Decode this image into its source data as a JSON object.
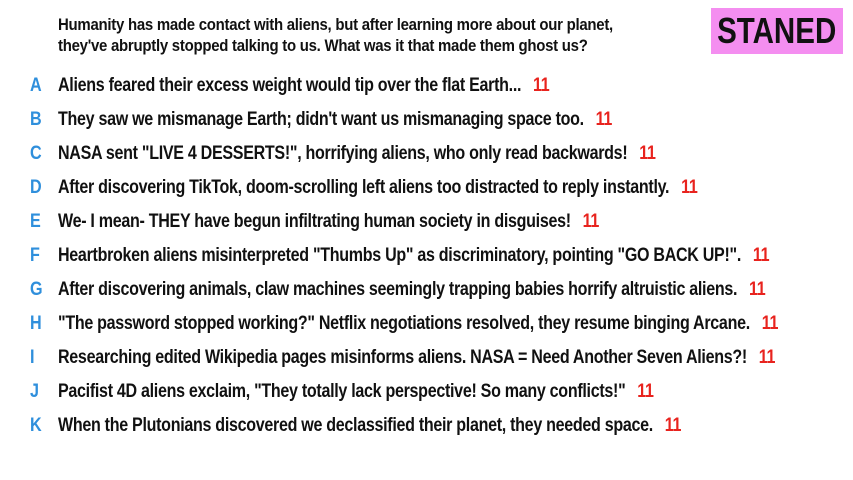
{
  "prompt": {
    "line1": "Humanity has made contact with aliens, but after learning more about our planet,",
    "line2": "they've abruptly stopped talking to us. What was it that made them ghost us?"
  },
  "badge": {
    "label": "STANED",
    "color": "#f48ef0"
  },
  "colors": {
    "letter": "#2f8fdc",
    "score": "#e8231e"
  },
  "answers": [
    {
      "letter": "A",
      "text": "Aliens feared their excess weight would tip over the flat Earth...",
      "score": "11"
    },
    {
      "letter": "B",
      "text": "They saw we mismanage Earth; didn't want us mismanaging space too.",
      "score": "11"
    },
    {
      "letter": "C",
      "text": "NASA sent \"LIVE 4 DESSERTS!\", horrifying aliens, who only read backwards!",
      "score": "11"
    },
    {
      "letter": "D",
      "text": "After discovering TikTok, doom-scrolling left aliens too distracted to reply instantly.",
      "score": "11"
    },
    {
      "letter": "E",
      "text": "We- I mean- THEY have begun infiltrating human society in disguises!",
      "score": "11"
    },
    {
      "letter": "F",
      "text": "Heartbroken aliens misinterpreted \"Thumbs Up\" as discriminatory, pointing \"GO BACK UP!\".",
      "score": "11"
    },
    {
      "letter": "G",
      "text": "After discovering animals, claw machines seemingly trapping babies horrify altruistic aliens.",
      "score": "11"
    },
    {
      "letter": "H",
      "text": "\"The password stopped working?\" Netflix negotiations resolved, they resume binging Arcane.",
      "score": "11"
    },
    {
      "letter": "I",
      "text": "Researching edited Wikipedia pages misinforms aliens. NASA = Need Another Seven Aliens?!",
      "score": "11"
    },
    {
      "letter": "J",
      "text": "Pacifist 4D aliens exclaim, \"They totally lack perspective! So many conflicts!\"",
      "score": "11"
    },
    {
      "letter": "K",
      "text": "When the Plutonians discovered we declassified their planet, they needed space.",
      "score": "11"
    }
  ]
}
